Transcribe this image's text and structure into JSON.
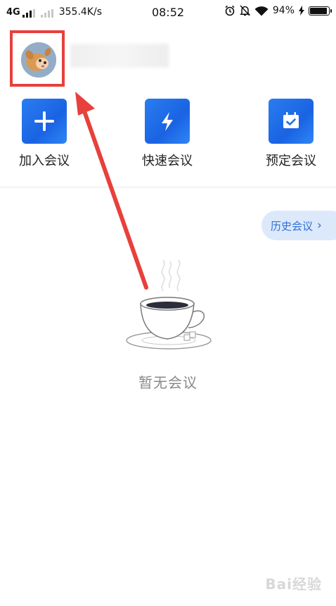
{
  "status_bar": {
    "network": "4G",
    "speed": "355.4K/s",
    "time": "08:52",
    "battery": "94%",
    "battery_level": 0.94,
    "icons": [
      "alarm-icon",
      "silent-bell-icon",
      "wifi-icon",
      "charging-icon"
    ]
  },
  "actions": [
    {
      "label": "加入会议",
      "icon": "plus-icon"
    },
    {
      "label": "快速会议",
      "icon": "lightning-icon"
    },
    {
      "label": "预定会议",
      "icon": "calendar-check-icon"
    }
  ],
  "history_button": {
    "label": "历史会议",
    "icon": "chevron-right-icon"
  },
  "empty_state": {
    "text": "暂无会议",
    "icon": "coffee-cup-icon"
  },
  "watermark": {
    "text": "Bai经验"
  },
  "colors": {
    "accent": "#1f6fe8",
    "annotation_red": "#e8403c",
    "history_bg": "#dbe9fb",
    "history_text": "#2f6fd6"
  }
}
